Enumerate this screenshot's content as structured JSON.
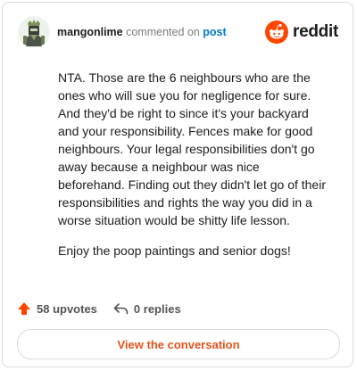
{
  "header": {
    "username": "mangonlime",
    "action_text": "commented on",
    "target_link": "post",
    "brand_name": "reddit",
    "brand_color": "#ff4500",
    "avatar_icon": "knight-avatar"
  },
  "comment": {
    "paragraphs": [
      "NTA. Those are the 6 neighbours who are the ones who will sue you for negligence for sure. And they'd be right to since it's your backyard and your responsibility. Fences make for good neighbours. Your legal responsibilities don't go away because a neighbour was nice beforehand. Finding out they didn't let go of their responsibilities and rights the way you did in a worse situation would be shitty life lesson.",
      "Enjoy the poop paintings and senior dogs!"
    ]
  },
  "footer": {
    "upvotes": "58 upvotes",
    "replies": "0 replies",
    "upvote_color": "#ff4500",
    "cta_label": "View the conversation"
  }
}
